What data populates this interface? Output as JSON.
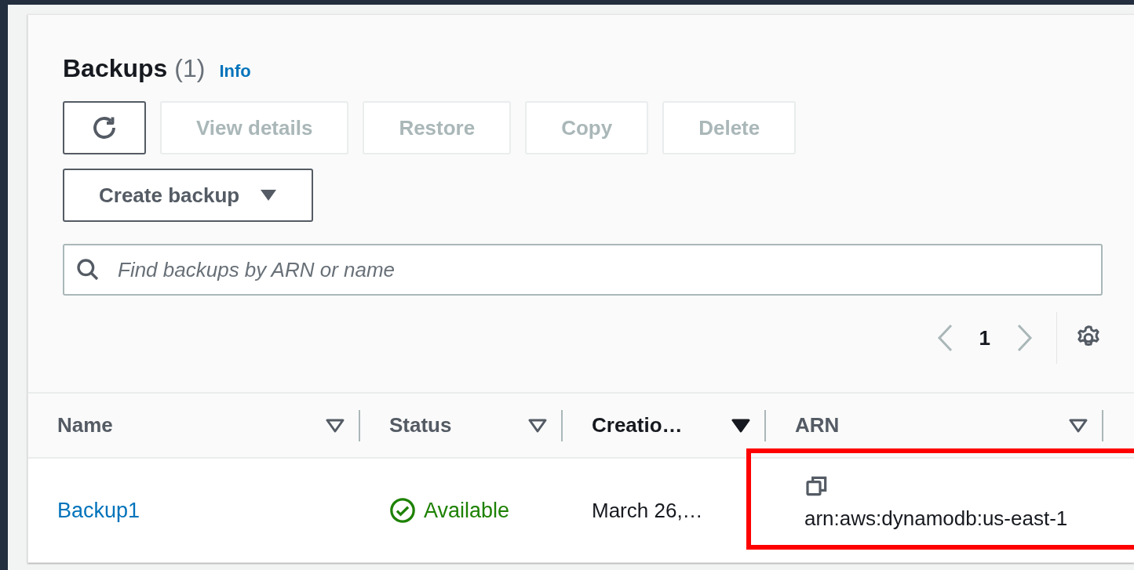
{
  "panel": {
    "title": "Backups",
    "count": "(1)",
    "info_link": "Info"
  },
  "actions": [
    {
      "kind": "refresh",
      "disabled": false
    },
    {
      "kind": "text",
      "label": "View details",
      "disabled": true
    },
    {
      "kind": "text",
      "label": "Restore",
      "disabled": true
    },
    {
      "kind": "text",
      "label": "Copy",
      "disabled": true
    },
    {
      "kind": "text",
      "label": "Delete",
      "disabled": true
    }
  ],
  "create_button": {
    "label": "Create backup"
  },
  "search": {
    "placeholder": "Find backups by ARN or name"
  },
  "pagination": {
    "page": "1",
    "prev_disabled": true,
    "next_disabled": true
  },
  "table": {
    "columns": [
      {
        "label": "Name",
        "sorted": false
      },
      {
        "label": "Status",
        "sorted": false
      },
      {
        "label": "Creatio…",
        "sorted": true
      },
      {
        "label": "ARN",
        "sorted": false
      }
    ],
    "rows": [
      {
        "name": "Backup1",
        "status": "Available",
        "created": "March 26,…",
        "arn": "arn:aws:dynamodb:us-east-1",
        "arn_highlighted": true
      }
    ]
  }
}
